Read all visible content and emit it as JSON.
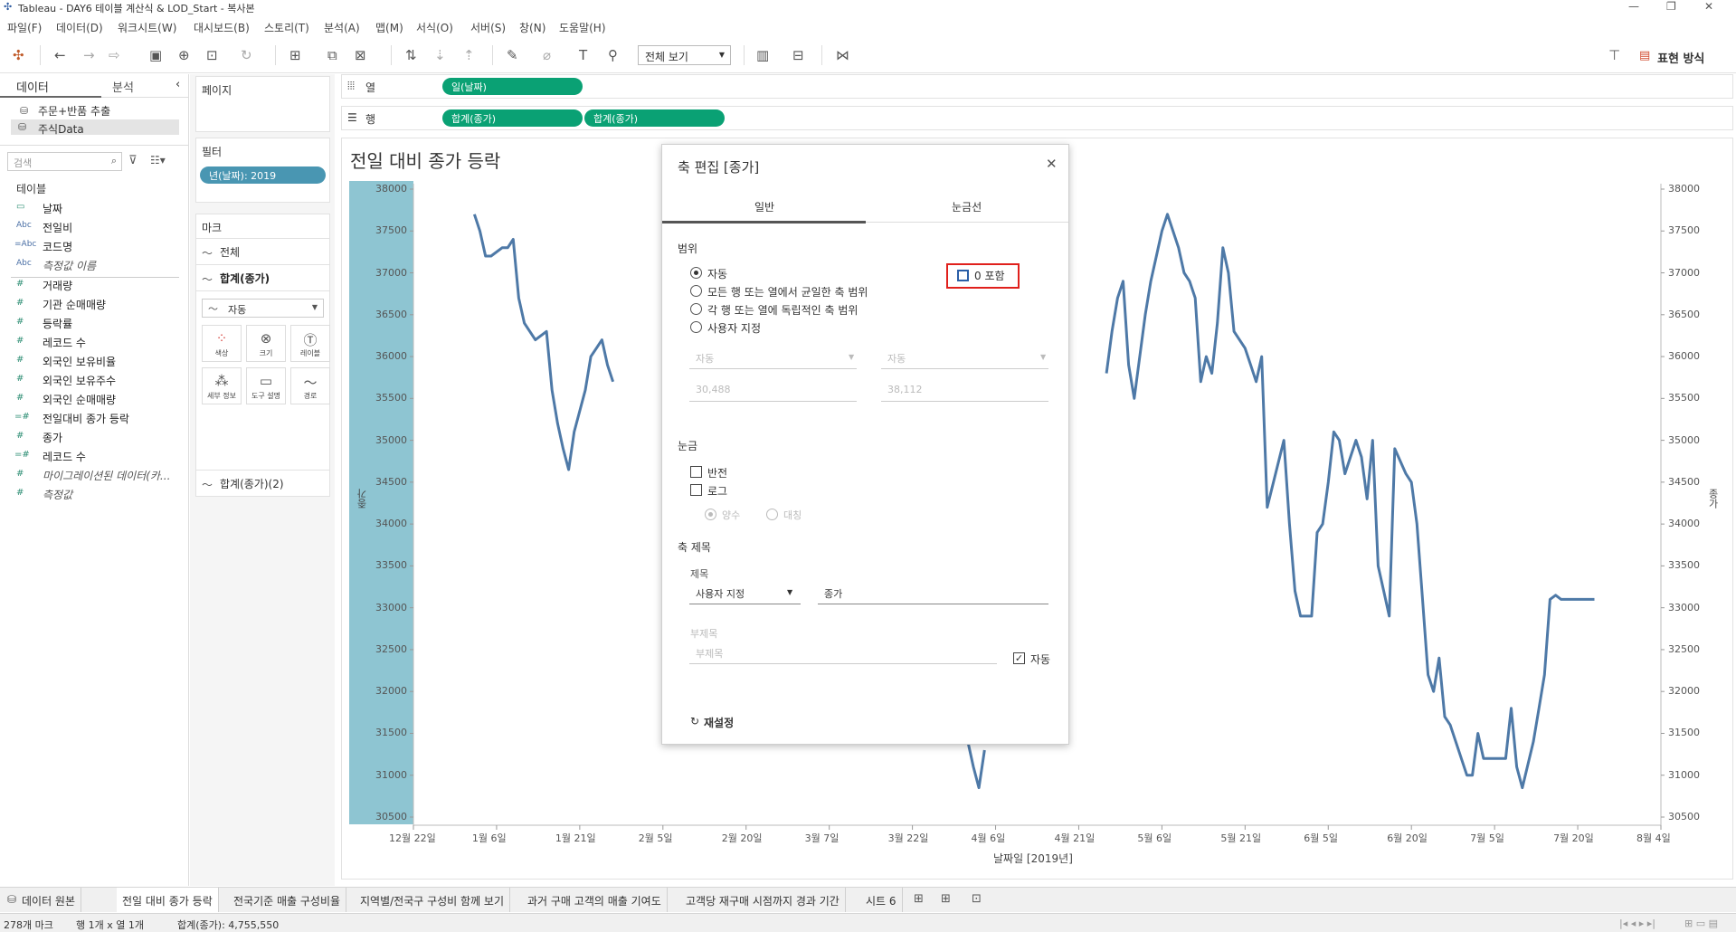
{
  "window": {
    "title": "Tableau - DAY6 테이블 계산식 & LOD_Start - 복사본",
    "minimize": "—",
    "restore": "❐",
    "close": "✕"
  },
  "menu": [
    "파일(F)",
    "데이터(D)",
    "워크시트(W)",
    "대시보드(B)",
    "스토리(T)",
    "분석(A)",
    "맵(M)",
    "서식(O)",
    "서버(S)",
    "창(N)",
    "도움말(H)"
  ],
  "toolbar": {
    "view_select": "전체 보기",
    "show_me_label": "표현 방식"
  },
  "data_pane": {
    "tab_data": "데이터",
    "tab_analysis": "분석",
    "collapse": "‹",
    "sources": [
      "주문+반품 추출",
      "주식Data"
    ],
    "search_placeholder": "검색",
    "tables_header": "테이블",
    "fields": [
      {
        "icon": "▭",
        "name": "날짜"
      },
      {
        "icon": "Abc",
        "name": "전일비"
      },
      {
        "icon": "=Abc",
        "name": "코드명"
      },
      {
        "icon": "Abc",
        "name": "측정값 이름"
      },
      {
        "icon": "#",
        "name": "거래량"
      },
      {
        "icon": "#",
        "name": "기관 순매매량"
      },
      {
        "icon": "#",
        "name": "등락률"
      },
      {
        "icon": "#",
        "name": "레코드 수"
      },
      {
        "icon": "#",
        "name": "외국인 보유비율"
      },
      {
        "icon": "#",
        "name": "외국인 보유주수"
      },
      {
        "icon": "#",
        "name": "외국인 순매매량"
      },
      {
        "icon": "=#",
        "name": "전일대비 종가 등락"
      },
      {
        "icon": "#",
        "name": "종가"
      },
      {
        "icon": "=#",
        "name": "레코드 수"
      },
      {
        "icon": "#",
        "name": "마이그레이션된 데이터(카..."
      },
      {
        "icon": "#",
        "name": "측정값"
      }
    ]
  },
  "shelves": {
    "pages": "페이지",
    "filters": "필터",
    "filter_pill": "년(날짜): 2019",
    "marks": "마크",
    "marks_all": "전체",
    "marks_sum": "합계(종가)",
    "mark_type": "자동",
    "mark_buttons": [
      "색상",
      "크기",
      "레이블",
      "세부 정보",
      "도구 설명",
      "경로"
    ],
    "marks_sum2": "합계(종가)(2)",
    "columns_label": "열",
    "rows_label": "행",
    "columns_pill": "일(날짜)",
    "rows_pills": [
      "합계(종가)",
      "합계(종가)"
    ]
  },
  "chart_data": {
    "type": "line",
    "title": "전일 대비 종가 등락",
    "xlabel": "날짜일 [2019년]",
    "ylabel": "종가",
    "ylabel_right": "종가",
    "ylim": [
      30500,
      38000
    ],
    "y_ticks": [
      38000,
      37500,
      37000,
      36500,
      36000,
      35500,
      35000,
      34500,
      34000,
      33500,
      33000,
      32500,
      32000,
      31500,
      31000,
      30500
    ],
    "x_ticks": [
      "12월 22일",
      "1월 6일",
      "1월 21일",
      "2월 5일",
      "2월 20일",
      "3월 7일",
      "3월 22일",
      "4월 6일",
      "4월 21일",
      "5월 6일",
      "5월 21일",
      "6월 5일",
      "6월 20일",
      "7월 5일",
      "7월 20일",
      "8월 4일"
    ],
    "x_ticks_days": [
      -10,
      5,
      20,
      35,
      50,
      65,
      80,
      95,
      110,
      125,
      140,
      155,
      170,
      185,
      200,
      215
    ],
    "color": "#4e79a7",
    "series": [
      {
        "x": [
          1,
          2,
          3,
          4,
          6,
          7,
          8,
          9,
          10,
          11,
          12,
          14,
          15,
          16,
          17,
          18,
          19,
          21,
          22,
          23,
          24,
          25,
          26
        ],
        "y": [
          37700,
          37500,
          37200,
          37200,
          37300,
          37300,
          37400,
          36700,
          36400,
          36300,
          36200,
          36300,
          35600,
          35200,
          34900,
          34650,
          35100,
          35600,
          36000,
          36100,
          36200,
          35900,
          35700
        ]
      },
      {
        "x": [
          90,
          91,
          92,
          93
        ],
        "y": [
          31400,
          31100,
          30850,
          31300
        ]
      },
      {
        "x": [
          115,
          116,
          117,
          118,
          119,
          120,
          122,
          123,
          124,
          125,
          126,
          128,
          129,
          130,
          131,
          132,
          133,
          134,
          135,
          136,
          137,
          138,
          140,
          141,
          142,
          143,
          144,
          147,
          148,
          149,
          150,
          151,
          152,
          153,
          154,
          155,
          156,
          157,
          158,
          160,
          161,
          162,
          163,
          164,
          165,
          166,
          167,
          169,
          170,
          171,
          172,
          173,
          174,
          175,
          176,
          177,
          180,
          181,
          182,
          183,
          185,
          186,
          187,
          188,
          189,
          190,
          192,
          193,
          194,
          195,
          196,
          197,
          198,
          199,
          200,
          201,
          202,
          203
        ],
        "y": [
          35800,
          36300,
          36700,
          36900,
          35900,
          35500,
          36500,
          36900,
          37200,
          37500,
          37700,
          37300,
          37000,
          36900,
          36700,
          35700,
          36000,
          35800,
          36400,
          37300,
          37000,
          36300,
          36100,
          35900,
          35700,
          36000,
          34200,
          35000,
          34000,
          33200,
          32900,
          32900,
          32900,
          33900,
          34000,
          34500,
          35100,
          35000,
          34600,
          35000,
          34800,
          34300,
          35000,
          33500,
          33200,
          32900,
          34900,
          34600,
          34500,
          34000,
          33100,
          32200,
          32000,
          32400,
          31700,
          31600,
          31000,
          31000,
          31500,
          31200,
          31200,
          31200,
          31200,
          31800,
          31100,
          30850,
          31400,
          31800,
          32200,
          33100,
          33150,
          33100,
          33100,
          33100,
          33100,
          33100,
          33100,
          33100
        ]
      }
    ]
  },
  "dialog": {
    "title": "축 편집 [종가]",
    "close": "✕",
    "tab_general": "일반",
    "tab_ticks": "눈금선",
    "range_header": "범위",
    "range_options": [
      "자동",
      "모든 행 또는 열에서 균일한 축 범위",
      "각 행 또는 열에 독립적인 축 범위",
      "사용자 지정"
    ],
    "include_zero": "0 포함",
    "fixed_start_sel": "자동",
    "fixed_end_sel": "자동",
    "start_value": "30,488",
    "end_value": "38,112",
    "scale_header": "눈금",
    "reversed": "반전",
    "logarithmic": "로그",
    "positive": "양수",
    "symmetric": "대칭",
    "axis_title_header": "축 제목",
    "title_label": "제목",
    "title_mode": "사용자 지정",
    "title_value": "종가",
    "subtitle_label": "부제목",
    "subtitle_placeholder": "부제목",
    "subtitle_auto": "자동",
    "reset": "재설정"
  },
  "sheet_tabs": [
    "데이터 원본",
    "전일 대비 종가 등락",
    "전국기준 매출 구성비율",
    "지역별/전국구 구성비 함께 보기",
    "과거 구매 고객의 매출 기여도",
    "고객당 재구매 시점까지 경과 기간",
    "시트 6"
  ],
  "status": {
    "marks": "278개 마크",
    "rows_cols": "행 1개 x 열 1개",
    "sum": "합계(종가): 4,755,550"
  }
}
